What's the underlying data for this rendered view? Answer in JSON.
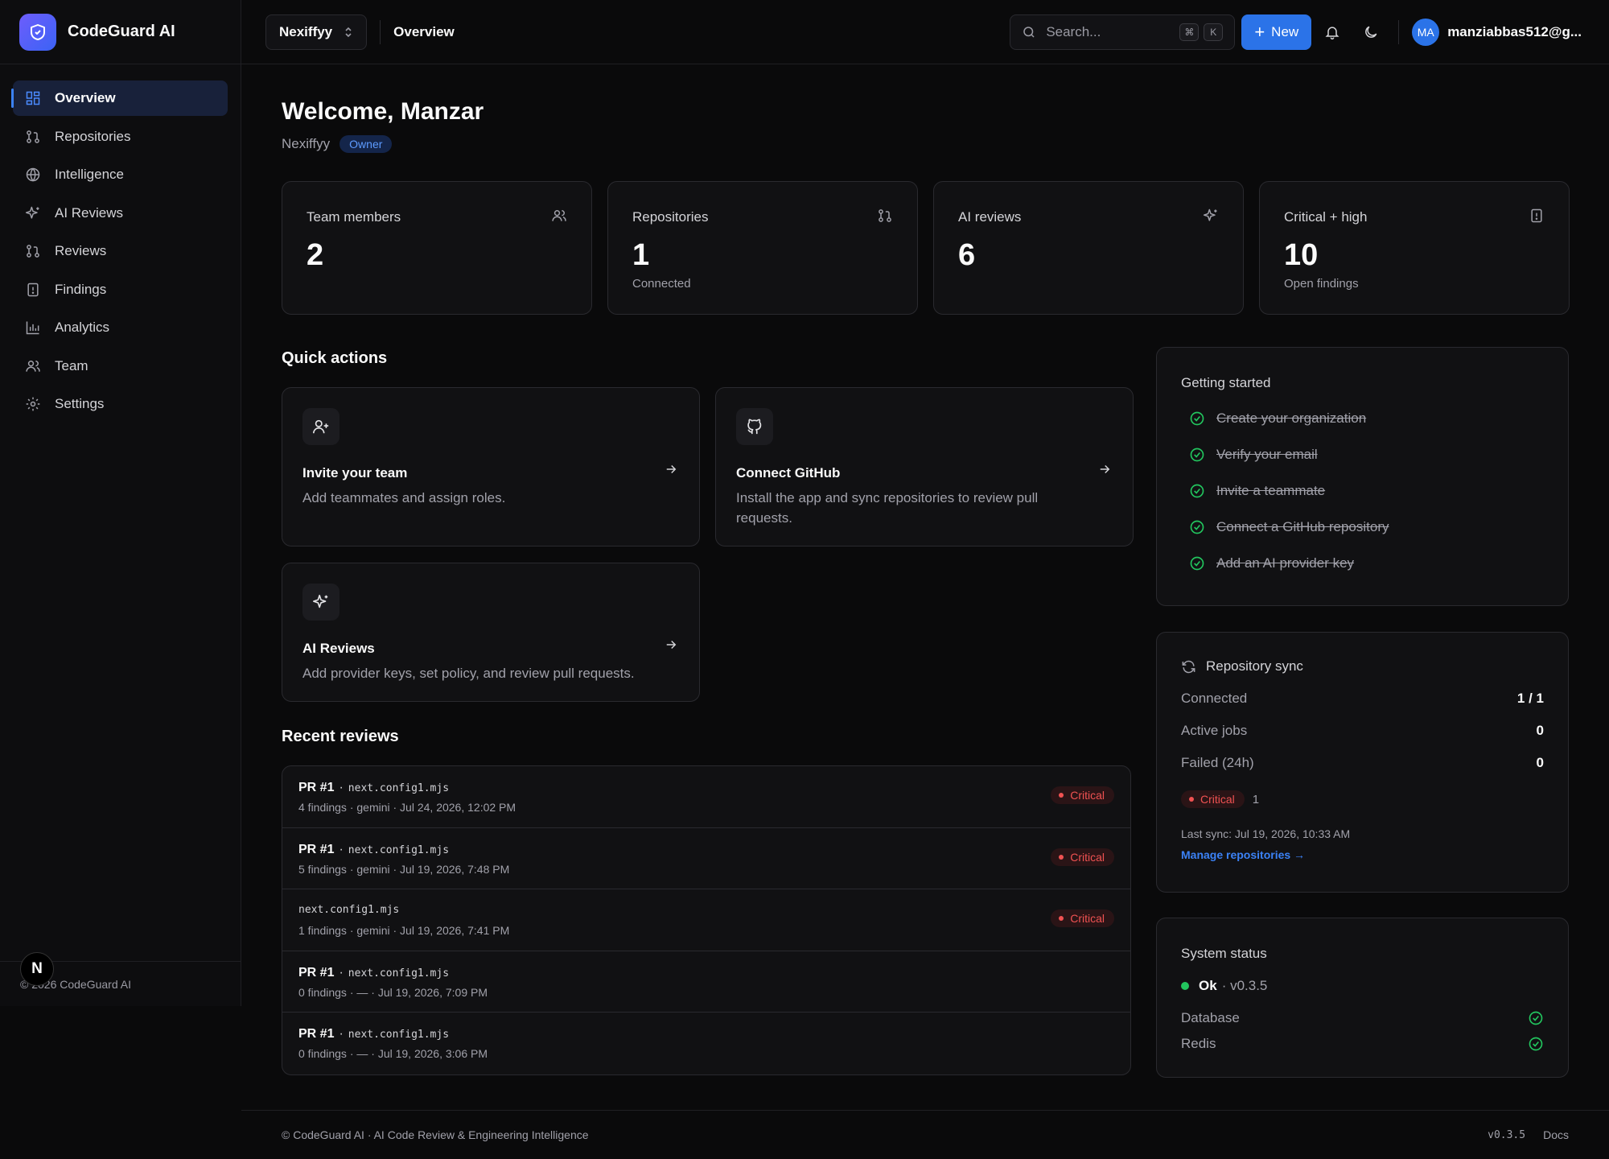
{
  "app": {
    "name": "CodeGuard AI",
    "footer_copyright": "© 2026 CodeGuard AI"
  },
  "sidebar": {
    "items": [
      {
        "label": "Overview",
        "icon": "grid-icon",
        "active": true
      },
      {
        "label": "Repositories",
        "icon": "git-pull-request-icon"
      },
      {
        "label": "Intelligence",
        "icon": "globe-icon"
      },
      {
        "label": "AI Reviews",
        "icon": "sparkles-icon"
      },
      {
        "label": "Reviews",
        "icon": "git-pull-request-icon"
      },
      {
        "label": "Findings",
        "icon": "alert-file-icon"
      },
      {
        "label": "Analytics",
        "icon": "bar-chart-icon"
      },
      {
        "label": "Team",
        "icon": "users-icon"
      },
      {
        "label": "Settings",
        "icon": "gear-icon"
      }
    ],
    "badge_letter": "N"
  },
  "topbar": {
    "org": "Nexiffyy",
    "breadcrumb": "Overview",
    "search_placeholder": "Search...",
    "kbd_cmd": "⌘",
    "kbd_key": "K",
    "new_label": "New",
    "avatar_initials": "MA",
    "user_email": "manziabbas512@g..."
  },
  "header": {
    "welcome": "Welcome, Manzar",
    "org": "Nexiffyy",
    "role_badge": "Owner"
  },
  "stats": [
    {
      "label": "Team members",
      "value": "2",
      "sub": "",
      "icon": "users-icon"
    },
    {
      "label": "Repositories",
      "value": "1",
      "sub": "Connected",
      "icon": "git-pull-request-icon"
    },
    {
      "label": "AI reviews",
      "value": "6",
      "sub": "",
      "icon": "sparkles-icon"
    },
    {
      "label": "Critical + high",
      "value": "10",
      "sub": "Open findings",
      "icon": "alert-file-icon"
    }
  ],
  "quick_actions": {
    "title": "Quick actions",
    "items": [
      {
        "title": "Invite your team",
        "desc": "Add teammates and assign roles.",
        "icon": "user-plus-icon"
      },
      {
        "title": "Connect GitHub",
        "desc": "Install the app and sync repositories to review pull requests.",
        "icon": "github-icon"
      },
      {
        "title": "AI Reviews",
        "desc": "Add provider keys, set policy, and review pull requests.",
        "icon": "sparkles-icon"
      }
    ]
  },
  "recent_reviews": {
    "title": "Recent reviews",
    "rows": [
      {
        "pr": "PR #1",
        "sep": "·",
        "file": "next.config1.mjs",
        "meta": "4 findings · gemini · Jul 24, 2026, 12:02 PM",
        "severity": "Critical"
      },
      {
        "pr": "PR #1",
        "sep": "·",
        "file": "next.config1.mjs",
        "meta": "5 findings · gemini · Jul 19, 2026, 7:48 PM",
        "severity": "Critical"
      },
      {
        "pr": "",
        "sep": "",
        "file": "next.config1.mjs",
        "meta": "1 findings · gemini · Jul 19, 2026, 7:41 PM",
        "severity": "Critical"
      },
      {
        "pr": "PR #1",
        "sep": "·",
        "file": "next.config1.mjs",
        "meta": "0 findings · — · Jul 19, 2026, 7:09 PM",
        "severity": ""
      },
      {
        "pr": "PR #1",
        "sep": "·",
        "file": "next.config1.mjs",
        "meta": "0 findings · — · Jul 19, 2026, 3:06 PM",
        "severity": ""
      }
    ]
  },
  "getting_started": {
    "title": "Getting started",
    "items": [
      "Create your organization",
      "Verify your email",
      "Invite a teammate",
      "Connect a GitHub repository",
      "Add an AI provider key"
    ]
  },
  "repo_sync": {
    "title": "Repository sync",
    "connected_label": "Connected",
    "connected_value": "1 / 1",
    "active_label": "Active jobs",
    "active_value": "0",
    "failed_label": "Failed (24h)",
    "failed_value": "0",
    "severity_label": "Critical",
    "severity_count": "1",
    "last_sync": "Last sync: Jul 19, 2026, 10:33 AM",
    "manage_link": "Manage repositories →"
  },
  "system_status": {
    "title": "System status",
    "status": "Ok",
    "version": "· v0.3.5",
    "services": [
      "Database",
      "Redis"
    ]
  },
  "footer": {
    "left": "© CodeGuard AI · AI Code Review & Engineering Intelligence",
    "version": "v0.3.5",
    "docs": "Docs"
  },
  "colors": {
    "accent": "#2b73e8",
    "critical": "#f05252",
    "success": "#22c55e",
    "background": "#0a0a0b"
  }
}
